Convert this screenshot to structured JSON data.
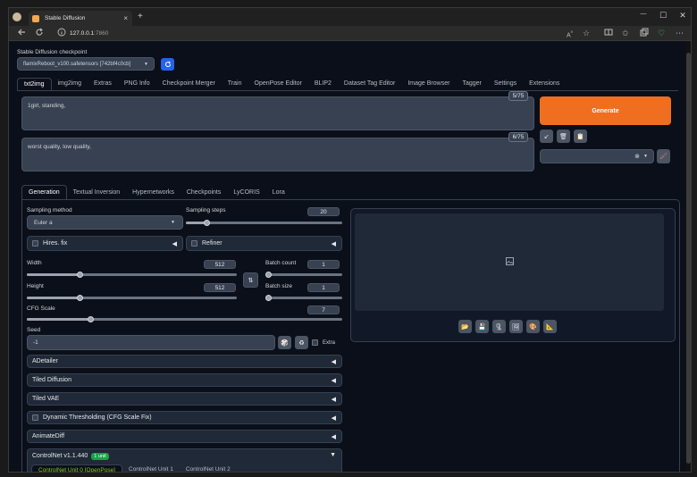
{
  "browser": {
    "tab_title": "Stable Diffusion",
    "url_host": "127.0.0.1",
    "url_port": ":7860",
    "new_tab": "+",
    "tab_close": "×",
    "minimize": "—",
    "maximize": "☐",
    "close": "✕"
  },
  "checkpoint": {
    "label": "Stable Diffusion checkpoint",
    "value": "flamixReboot_v100.safetensors [742bf4c0cb]"
  },
  "main_tabs": [
    "txt2img",
    "img2img",
    "Extras",
    "PNG Info",
    "Checkpoint Merger",
    "Train",
    "OpenPose Editor",
    "BLIP2",
    "Dataset Tag Editor",
    "Image Browser",
    "Tagger",
    "Settings",
    "Extensions"
  ],
  "prompt": {
    "text": "1girl, standing,",
    "counter": "5/75"
  },
  "negative_prompt": {
    "text": "worst quality, low quality,",
    "counter": "6/75"
  },
  "generate_label": "Generate",
  "sub_tabs": [
    "Generation",
    "Textual Inversion",
    "Hypernetworks",
    "Checkpoints",
    "LyCORIS",
    "Lora"
  ],
  "sampling": {
    "method_label": "Sampling method",
    "method_value": "Euler a",
    "steps_label": "Sampling steps",
    "steps_value": "20",
    "steps_fraction": 0.13
  },
  "hires_label": "Hires. fix",
  "refiner_label": "Refiner",
  "width": {
    "label": "Width",
    "value": "512",
    "fraction": 0.25
  },
  "height": {
    "label": "Height",
    "value": "512",
    "fraction": 0.25
  },
  "batch_count": {
    "label": "Batch count",
    "value": "1",
    "fraction": 0.0
  },
  "batch_size": {
    "label": "Batch size",
    "value": "1",
    "fraction": 0.0
  },
  "cfg": {
    "label": "CFG Scale",
    "value": "7",
    "fraction": 0.2
  },
  "seed": {
    "label": "Seed",
    "value": "-1",
    "extra_label": "Extra"
  },
  "accordions": [
    "ADetailer",
    "Tiled Diffusion",
    "Tiled VAE",
    "Dynamic Thresholding (CFG Scale Fix)",
    "AnimateDiff"
  ],
  "controlnet": {
    "label": "ControlNet v1.1.440",
    "badge": "1 unit",
    "units": [
      "ControlNet Unit 0 [OpenPose]",
      "ControlNet Unit 1",
      "ControlNet Unit 2"
    ]
  },
  "colors": {
    "accent": "#f06e1f",
    "badge": "#16a34a",
    "unit_active": "#84cc16",
    "background": "#0b0f19"
  }
}
